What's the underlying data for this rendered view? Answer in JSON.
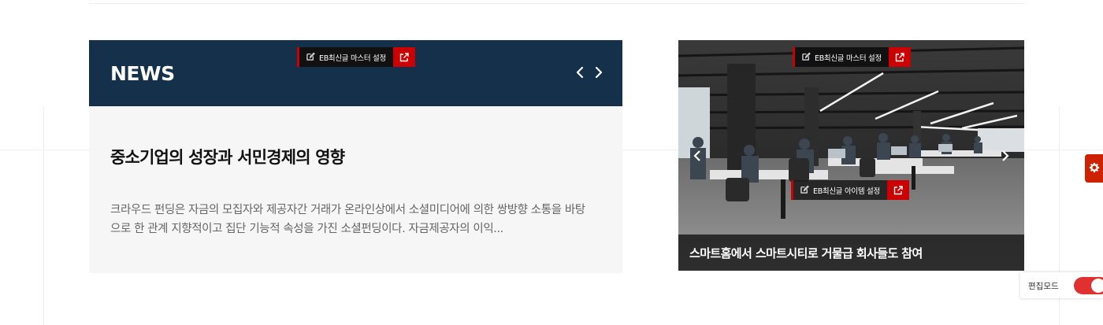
{
  "news": {
    "title": "NEWS",
    "headline": "중소기업의 성장과 서민경제의 영향",
    "excerpt": "크라우드 펀딩은 자금의 모집자와 제공자간 거래가 온라인상에서 소셜미디어에 의한 쌍방향 소통을 바탕으로 한 관계 지향적이고 집단 기능적 속성을 가진 소셜펀딩이다. 자금제공자의 이익...",
    "header_color": "#14304a"
  },
  "admin": {
    "latest_posts_master": "EB최신글 마스터 설정",
    "item_settings": "EB최신글 아이템 설정"
  },
  "slider": {
    "caption": "스마트홈에서 스마트시티로 거물급 회사들도 참여"
  },
  "edit_mode": {
    "label": "편집모드",
    "on": true
  },
  "colors": {
    "accent": "#cc0000",
    "dark": "#111111"
  },
  "icons": {
    "edit": "edit-icon",
    "external": "external-link-icon",
    "prev": "chevron-left-icon",
    "next": "chevron-right-icon",
    "settings": "gear-icon"
  }
}
